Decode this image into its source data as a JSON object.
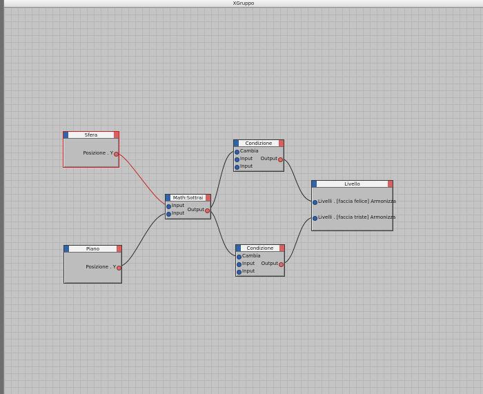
{
  "window": {
    "title": "XGruppo"
  },
  "nodes": {
    "sfera": {
      "title": "Sfera",
      "outputs": [
        "Posizione . Y"
      ]
    },
    "piano": {
      "title": "Piano",
      "outputs": [
        "Posizione . Y"
      ]
    },
    "math": {
      "title": "Math:Sottrai",
      "inputs": [
        "Input",
        "Input"
      ],
      "output": "Output"
    },
    "cond1": {
      "title": "Condizione",
      "inputs": [
        "Cambia",
        "Input",
        "Input"
      ],
      "output": "Output"
    },
    "cond2": {
      "title": "Condizione",
      "inputs": [
        "Cambia",
        "Input",
        "Input"
      ],
      "output": "Output"
    },
    "livello": {
      "title": "Livello",
      "inputs": [
        "Livelli . [faccia felice] Armonizza",
        "Livelli . [faccia triste] Armonizza"
      ]
    }
  },
  "colors": {
    "selected_wire": "#cc2222",
    "wire": "#2a2a2a",
    "input_port": "#2f5fa8",
    "output_port": "#dc6a68"
  }
}
